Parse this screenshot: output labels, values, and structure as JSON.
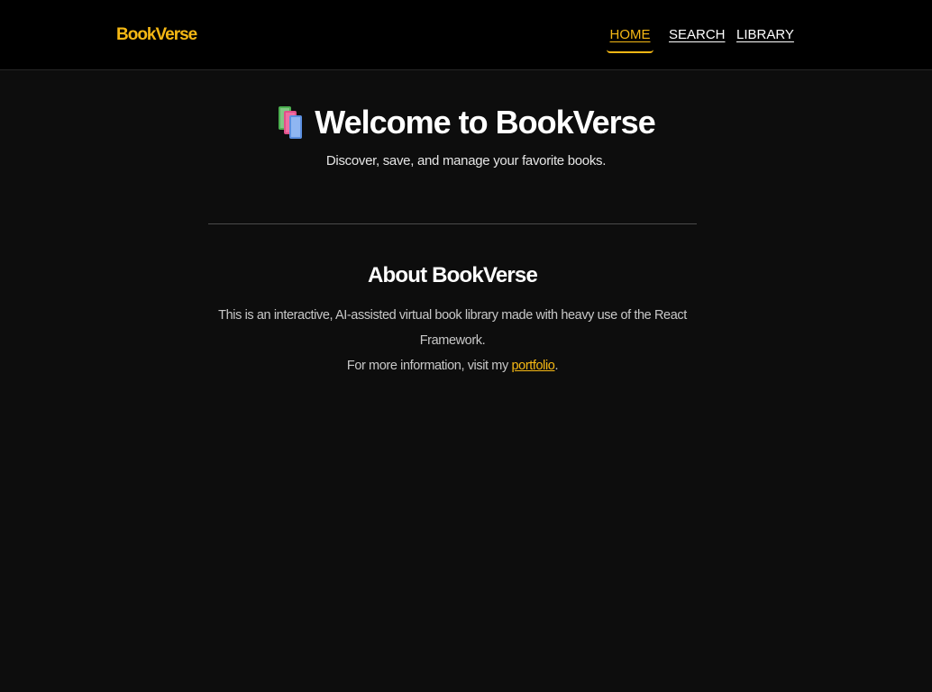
{
  "colors": {
    "accent": "#f5b814",
    "background": "#0d0d0d",
    "navbar_background": "#000000",
    "text": "#ffffff",
    "muted_text": "#c8c8c8"
  },
  "navbar": {
    "brand": "BookVerse",
    "links": [
      {
        "label": "HOME",
        "active": true
      },
      {
        "label": "SEARCH",
        "active": false
      },
      {
        "label": "LIBRARY",
        "active": false
      }
    ]
  },
  "hero": {
    "icon": "books-icon",
    "title": "Welcome to BookVerse",
    "subtitle": "Discover, save, and manage your favorite books."
  },
  "about": {
    "title": "About BookVerse",
    "description": "This is an interactive, AI-assisted virtual book library made with heavy use of the React Framework.",
    "more_info_prefix": "For more information, visit my",
    "link_label": "portfolio",
    "more_info_suffix": "."
  }
}
